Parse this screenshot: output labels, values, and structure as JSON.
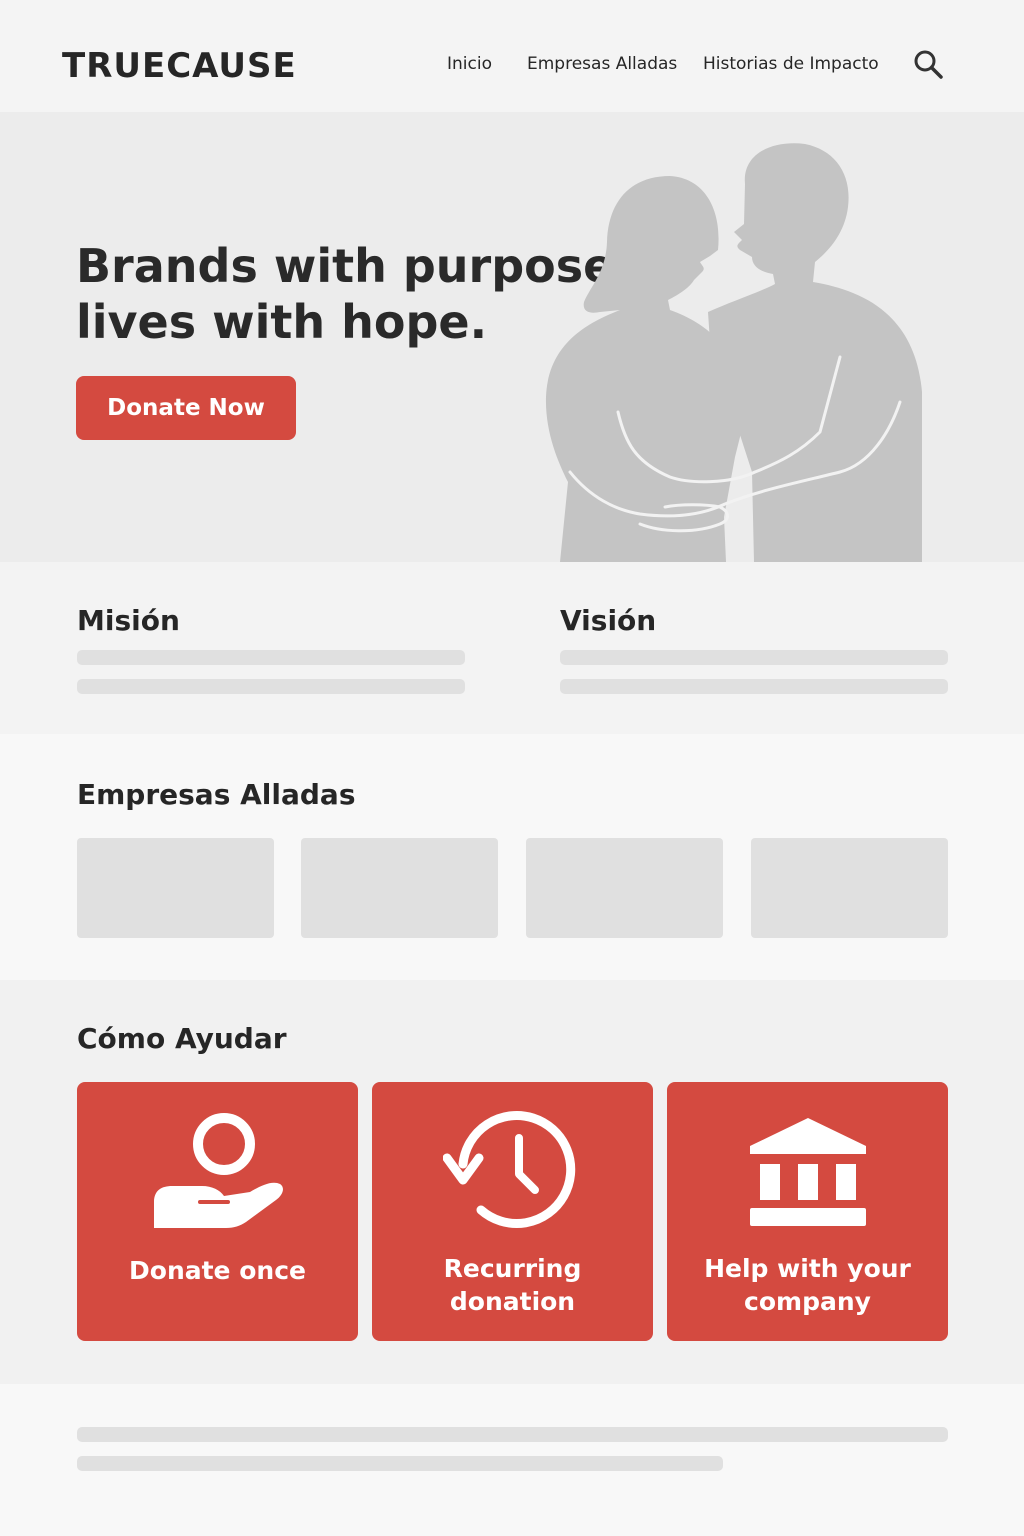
{
  "brand": {
    "logo": "TRUECAUSE",
    "accent_color": "#d44a40"
  },
  "nav": {
    "items": [
      {
        "label": "Inicio"
      },
      {
        "label": "Empresas Alladas"
      },
      {
        "label": "Historias de Impacto"
      }
    ],
    "search_icon": "search-icon"
  },
  "hero": {
    "title_line1": "Brands with purpose,",
    "title_line2": "lives with hope.",
    "cta_label": "Donate Now",
    "illustration": "couple-embracing-silhouette"
  },
  "mission": {
    "heading": "Misión"
  },
  "vision": {
    "heading": "Visión"
  },
  "partners": {
    "heading": "Empresas Alladas"
  },
  "help": {
    "heading": "Cómo Ayudar",
    "cards": [
      {
        "label_line1": "Donate once",
        "label_line2": "",
        "icon": "hand-coin-icon"
      },
      {
        "label_line1": "Recurring",
        "label_line2": "donation",
        "icon": "recurring-clock-icon"
      },
      {
        "label_line1": "Help with your",
        "label_line2": "company",
        "icon": "bank-building-icon"
      }
    ]
  }
}
